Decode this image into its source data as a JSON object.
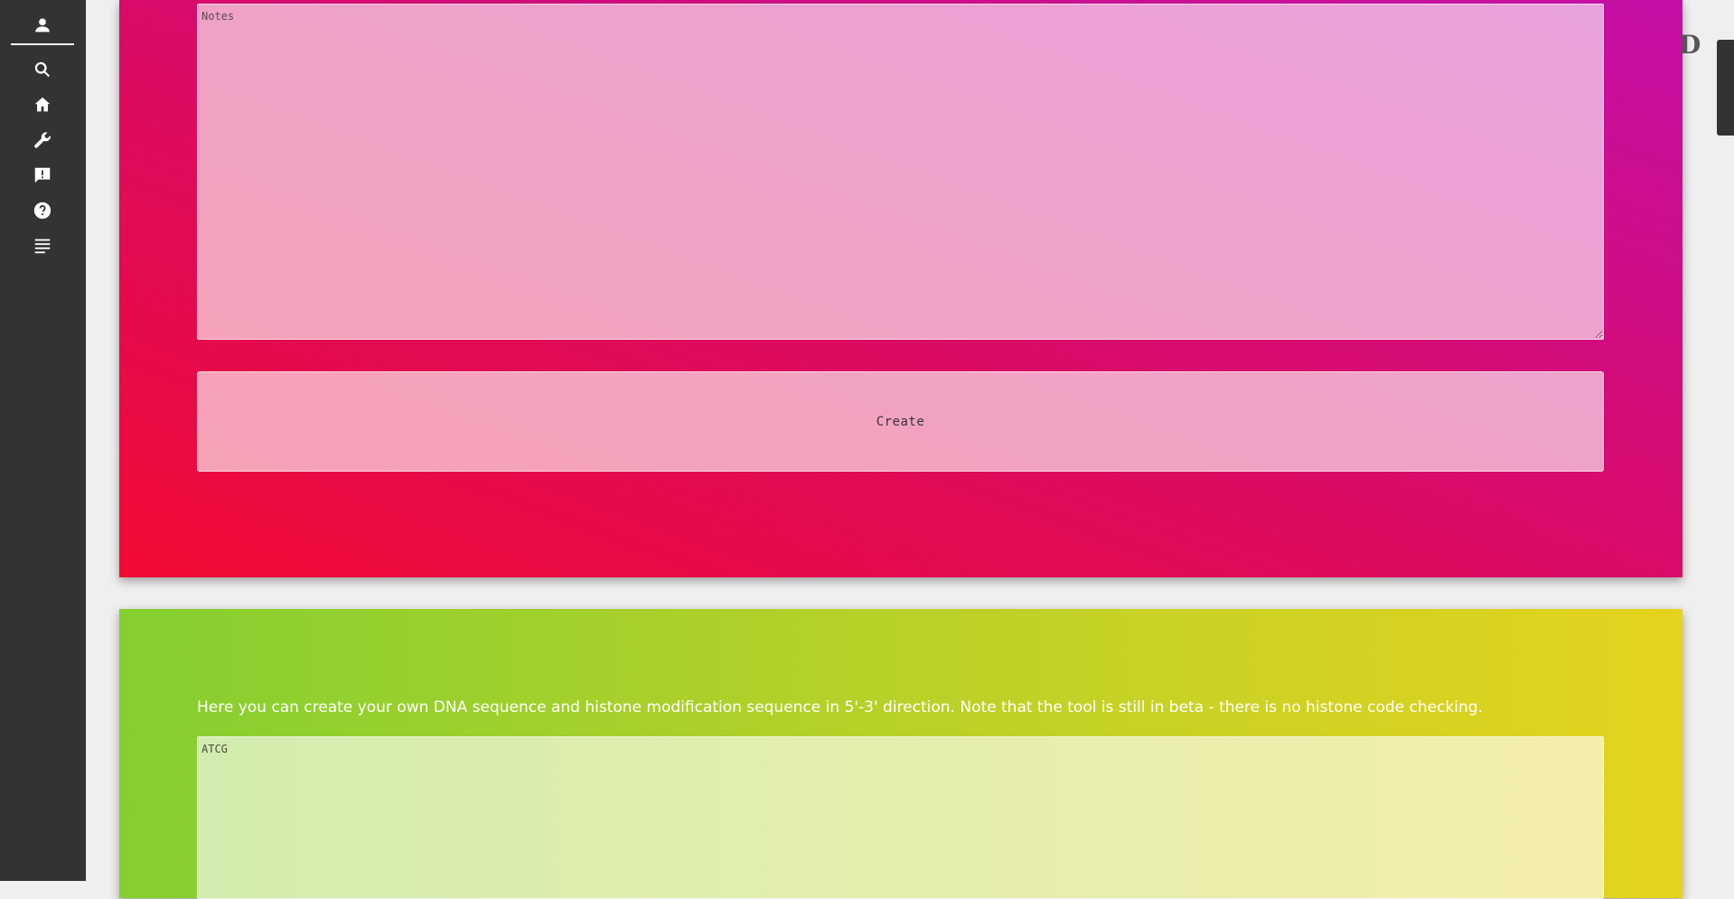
{
  "sidebar": {
    "icons": [
      "person-icon",
      "search-icon",
      "home-icon",
      "wrench-icon",
      "feedback-icon",
      "help-icon",
      "notes-list-icon"
    ]
  },
  "create_card": {
    "notes_placeholder": "Notes",
    "create_label": "Create",
    "gradient_colors": [
      "#f20a34",
      "#db0b62",
      "#c40fa6"
    ]
  },
  "sequence_card": {
    "info_before": "Here you can create your own DNA sequence and histone modification sequence in 5'-3' direction. Note that the tool is still in beta - there is ",
    "info_emphasis": "no",
    "info_after": " histone code checking.",
    "sequence_placeholder": "ATCG",
    "gradient_colors": [
      "#84cf30",
      "#b9d128",
      "#e5d31e"
    ]
  },
  "right_edge": {
    "partial_glyph": "D"
  }
}
